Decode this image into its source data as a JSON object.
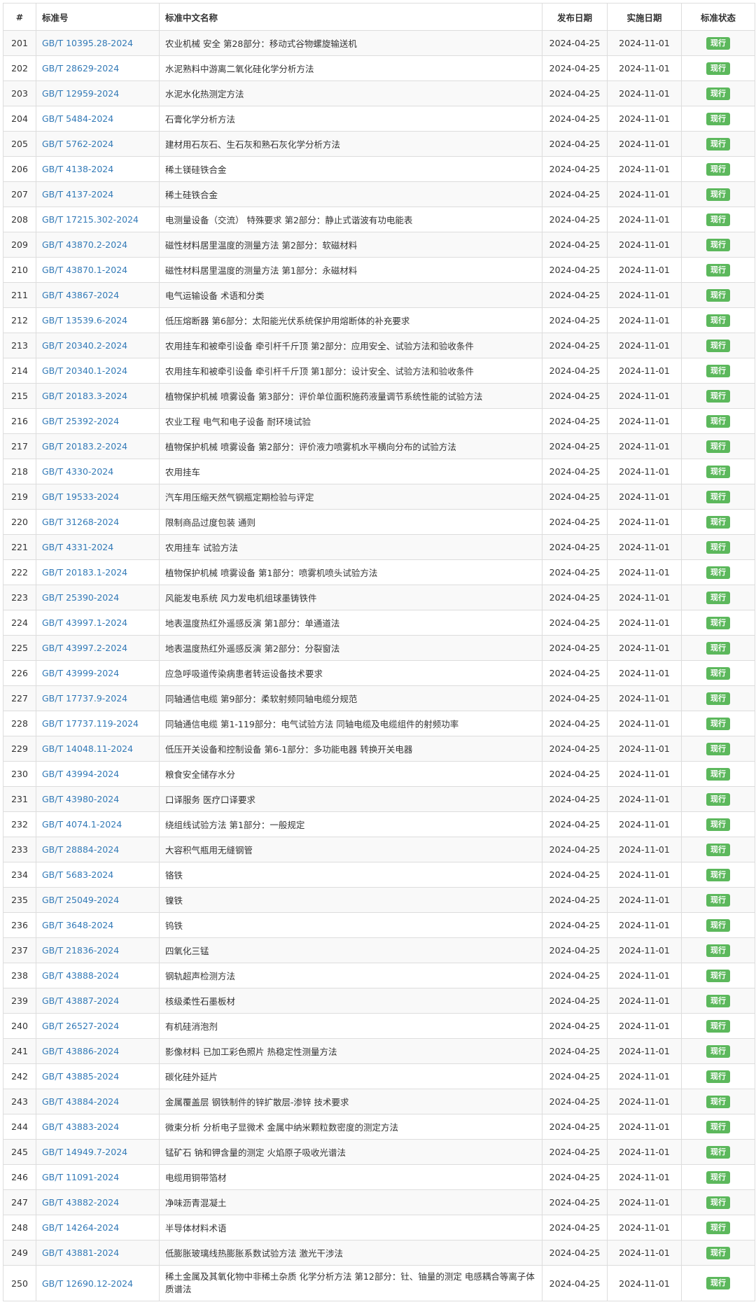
{
  "table": {
    "headers": {
      "num": "#",
      "code": "标准号",
      "name": "标准中文名称",
      "publish_date": "发布日期",
      "impl_date": "实施日期",
      "status": "标准状态"
    },
    "rows": [
      {
        "num": "201",
        "code": "GB/T 10395.28-2024",
        "name": "农业机械 安全 第28部分：移动式谷物螺旋输送机",
        "publish": "2024-04-25",
        "impl": "2024-11-01",
        "status": "现行"
      },
      {
        "num": "202",
        "code": "GB/T 28629-2024",
        "name": "水泥熟料中游离二氧化硅化学分析方法",
        "publish": "2024-04-25",
        "impl": "2024-11-01",
        "status": "现行"
      },
      {
        "num": "203",
        "code": "GB/T 12959-2024",
        "name": "水泥水化热测定方法",
        "publish": "2024-04-25",
        "impl": "2024-11-01",
        "status": "现行"
      },
      {
        "num": "204",
        "code": "GB/T 5484-2024",
        "name": "石膏化学分析方法",
        "publish": "2024-04-25",
        "impl": "2024-11-01",
        "status": "现行"
      },
      {
        "num": "205",
        "code": "GB/T 5762-2024",
        "name": "建材用石灰石、生石灰和熟石灰化学分析方法",
        "publish": "2024-04-25",
        "impl": "2024-11-01",
        "status": "现行"
      },
      {
        "num": "206",
        "code": "GB/T 4138-2024",
        "name": "稀土镁硅铁合金",
        "publish": "2024-04-25",
        "impl": "2024-11-01",
        "status": "现行"
      },
      {
        "num": "207",
        "code": "GB/T 4137-2024",
        "name": "稀土硅铁合金",
        "publish": "2024-04-25",
        "impl": "2024-11-01",
        "status": "现行"
      },
      {
        "num": "208",
        "code": "GB/T 17215.302-2024",
        "name": "电测量设备（交流） 特殊要求 第2部分：静止式谐波有功电能表",
        "publish": "2024-04-25",
        "impl": "2024-11-01",
        "status": "现行"
      },
      {
        "num": "209",
        "code": "GB/T 43870.2-2024",
        "name": "磁性材料居里温度的测量方法 第2部分：软磁材料",
        "publish": "2024-04-25",
        "impl": "2024-11-01",
        "status": "现行"
      },
      {
        "num": "210",
        "code": "GB/T 43870.1-2024",
        "name": "磁性材料居里温度的测量方法 第1部分：永磁材料",
        "publish": "2024-04-25",
        "impl": "2024-11-01",
        "status": "现行"
      },
      {
        "num": "211",
        "code": "GB/T 43867-2024",
        "name": "电气运输设备 术语和分类",
        "publish": "2024-04-25",
        "impl": "2024-11-01",
        "status": "现行"
      },
      {
        "num": "212",
        "code": "GB/T 13539.6-2024",
        "name": "低压熔断器 第6部分：太阳能光伏系统保护用熔断体的补充要求",
        "publish": "2024-04-25",
        "impl": "2024-11-01",
        "status": "现行"
      },
      {
        "num": "213",
        "code": "GB/T 20340.2-2024",
        "name": "农用挂车和被牵引设备 牵引杆千斤顶 第2部分：应用安全、试验方法和验收条件",
        "publish": "2024-04-25",
        "impl": "2024-11-01",
        "status": "现行"
      },
      {
        "num": "214",
        "code": "GB/T 20340.1-2024",
        "name": "农用挂车和被牵引设备 牵引杆千斤顶 第1部分：设计安全、试验方法和验收条件",
        "publish": "2024-04-25",
        "impl": "2024-11-01",
        "status": "现行"
      },
      {
        "num": "215",
        "code": "GB/T 20183.3-2024",
        "name": "植物保护机械 喷雾设备 第3部分：评价单位面积施药液量调节系统性能的试验方法",
        "publish": "2024-04-25",
        "impl": "2024-11-01",
        "status": "现行"
      },
      {
        "num": "216",
        "code": "GB/T 25392-2024",
        "name": "农业工程 电气和电子设备 耐环境试验",
        "publish": "2024-04-25",
        "impl": "2024-11-01",
        "status": "现行"
      },
      {
        "num": "217",
        "code": "GB/T 20183.2-2024",
        "name": "植物保护机械 喷雾设备 第2部分：评价液力喷雾机水平横向分布的试验方法",
        "publish": "2024-04-25",
        "impl": "2024-11-01",
        "status": "现行"
      },
      {
        "num": "218",
        "code": "GB/T 4330-2024",
        "name": "农用挂车",
        "publish": "2024-04-25",
        "impl": "2024-11-01",
        "status": "现行"
      },
      {
        "num": "219",
        "code": "GB/T 19533-2024",
        "name": "汽车用压缩天然气钢瓶定期检验与评定",
        "publish": "2024-04-25",
        "impl": "2024-11-01",
        "status": "现行"
      },
      {
        "num": "220",
        "code": "GB/T 31268-2024",
        "name": "限制商品过度包装 通则",
        "publish": "2024-04-25",
        "impl": "2024-11-01",
        "status": "现行"
      },
      {
        "num": "221",
        "code": "GB/T 4331-2024",
        "name": "农用挂车 试验方法",
        "publish": "2024-04-25",
        "impl": "2024-11-01",
        "status": "现行"
      },
      {
        "num": "222",
        "code": "GB/T 20183.1-2024",
        "name": "植物保护机械 喷雾设备 第1部分：喷雾机喷头试验方法",
        "publish": "2024-04-25",
        "impl": "2024-11-01",
        "status": "现行"
      },
      {
        "num": "223",
        "code": "GB/T 25390-2024",
        "name": "风能发电系统 风力发电机组球墨铸铁件",
        "publish": "2024-04-25",
        "impl": "2024-11-01",
        "status": "现行"
      },
      {
        "num": "224",
        "code": "GB/T 43997.1-2024",
        "name": "地表温度热红外遥感反演 第1部分：单通道法",
        "publish": "2024-04-25",
        "impl": "2024-11-01",
        "status": "现行"
      },
      {
        "num": "225",
        "code": "GB/T 43997.2-2024",
        "name": "地表温度热红外遥感反演 第2部分：分裂窗法",
        "publish": "2024-04-25",
        "impl": "2024-11-01",
        "status": "现行"
      },
      {
        "num": "226",
        "code": "GB/T 43999-2024",
        "name": "应急呼吸道传染病患者转运设备技术要求",
        "publish": "2024-04-25",
        "impl": "2024-11-01",
        "status": "现行"
      },
      {
        "num": "227",
        "code": "GB/T 17737.9-2024",
        "name": "同轴通信电缆 第9部分：柔软射频同轴电缆分规范",
        "publish": "2024-04-25",
        "impl": "2024-11-01",
        "status": "现行"
      },
      {
        "num": "228",
        "code": "GB/T 17737.119-2024",
        "name": "同轴通信电缆 第1-119部分：电气试验方法 同轴电缆及电缆组件的射频功率",
        "publish": "2024-04-25",
        "impl": "2024-11-01",
        "status": "现行"
      },
      {
        "num": "229",
        "code": "GB/T 14048.11-2024",
        "name": "低压开关设备和控制设备 第6-1部分：多功能电器 转换开关电器",
        "publish": "2024-04-25",
        "impl": "2024-11-01",
        "status": "现行"
      },
      {
        "num": "230",
        "code": "GB/T 43994-2024",
        "name": "粮食安全储存水分",
        "publish": "2024-04-25",
        "impl": "2024-11-01",
        "status": "现行"
      },
      {
        "num": "231",
        "code": "GB/T 43980-2024",
        "name": "口译服务 医疗口译要求",
        "publish": "2024-04-25",
        "impl": "2024-11-01",
        "status": "现行"
      },
      {
        "num": "232",
        "code": "GB/T 4074.1-2024",
        "name": "绕组线试验方法 第1部分：一般规定",
        "publish": "2024-04-25",
        "impl": "2024-11-01",
        "status": "现行"
      },
      {
        "num": "233",
        "code": "GB/T 28884-2024",
        "name": "大容积气瓶用无缝钢管",
        "publish": "2024-04-25",
        "impl": "2024-11-01",
        "status": "现行"
      },
      {
        "num": "234",
        "code": "GB/T 5683-2024",
        "name": "铬铁",
        "publish": "2024-04-25",
        "impl": "2024-11-01",
        "status": "现行"
      },
      {
        "num": "235",
        "code": "GB/T 25049-2024",
        "name": "镍铁",
        "publish": "2024-04-25",
        "impl": "2024-11-01",
        "status": "现行"
      },
      {
        "num": "236",
        "code": "GB/T 3648-2024",
        "name": "钨铁",
        "publish": "2024-04-25",
        "impl": "2024-11-01",
        "status": "现行"
      },
      {
        "num": "237",
        "code": "GB/T 21836-2024",
        "name": "四氧化三锰",
        "publish": "2024-04-25",
        "impl": "2024-11-01",
        "status": "现行"
      },
      {
        "num": "238",
        "code": "GB/T 43888-2024",
        "name": "钢轨超声检测方法",
        "publish": "2024-04-25",
        "impl": "2024-11-01",
        "status": "现行"
      },
      {
        "num": "239",
        "code": "GB/T 43887-2024",
        "name": "核级柔性石墨板材",
        "publish": "2024-04-25",
        "impl": "2024-11-01",
        "status": "现行"
      },
      {
        "num": "240",
        "code": "GB/T 26527-2024",
        "name": "有机硅消泡剂",
        "publish": "2024-04-25",
        "impl": "2024-11-01",
        "status": "现行"
      },
      {
        "num": "241",
        "code": "GB/T 43886-2024",
        "name": "影像材料 已加工彩色照片 热稳定性测量方法",
        "publish": "2024-04-25",
        "impl": "2024-11-01",
        "status": "现行"
      },
      {
        "num": "242",
        "code": "GB/T 43885-2024",
        "name": "碳化硅外延片",
        "publish": "2024-04-25",
        "impl": "2024-11-01",
        "status": "现行"
      },
      {
        "num": "243",
        "code": "GB/T 43884-2024",
        "name": "金属覆盖层 钢铁制件的锌扩散层-渗锌 技术要求",
        "publish": "2024-04-25",
        "impl": "2024-11-01",
        "status": "现行"
      },
      {
        "num": "244",
        "code": "GB/T 43883-2024",
        "name": "微束分析 分析电子显微术 金属中纳米颗粒数密度的测定方法",
        "publish": "2024-04-25",
        "impl": "2024-11-01",
        "status": "现行"
      },
      {
        "num": "245",
        "code": "GB/T 14949.7-2024",
        "name": "锰矿石 钠和钾含量的测定 火焰原子吸收光谱法",
        "publish": "2024-04-25",
        "impl": "2024-11-01",
        "status": "现行"
      },
      {
        "num": "246",
        "code": "GB/T 11091-2024",
        "name": "电缆用铜带箔材",
        "publish": "2024-04-25",
        "impl": "2024-11-01",
        "status": "现行"
      },
      {
        "num": "247",
        "code": "GB/T 43882-2024",
        "name": "净味沥青混凝土",
        "publish": "2024-04-25",
        "impl": "2024-11-01",
        "status": "现行"
      },
      {
        "num": "248",
        "code": "GB/T 14264-2024",
        "name": "半导体材料术语",
        "publish": "2024-04-25",
        "impl": "2024-11-01",
        "status": "现行"
      },
      {
        "num": "249",
        "code": "GB/T 43881-2024",
        "name": "低膨胀玻璃线热膨胀系数试验方法 激光干涉法",
        "publish": "2024-04-25",
        "impl": "2024-11-01",
        "status": "现行"
      },
      {
        "num": "250",
        "code": "GB/T 12690.12-2024",
        "name": "稀土金属及其氧化物中非稀土杂质 化学分析方法 第12部分：钍、铀量的测定 电感耦合等离子体质谱法",
        "publish": "2024-04-25",
        "impl": "2024-11-01",
        "status": "现行"
      }
    ]
  },
  "colors": {
    "link": "#337ab7",
    "badge": "#5cb85c",
    "stripe": "#f9f9f9",
    "border": "#dddddd"
  }
}
